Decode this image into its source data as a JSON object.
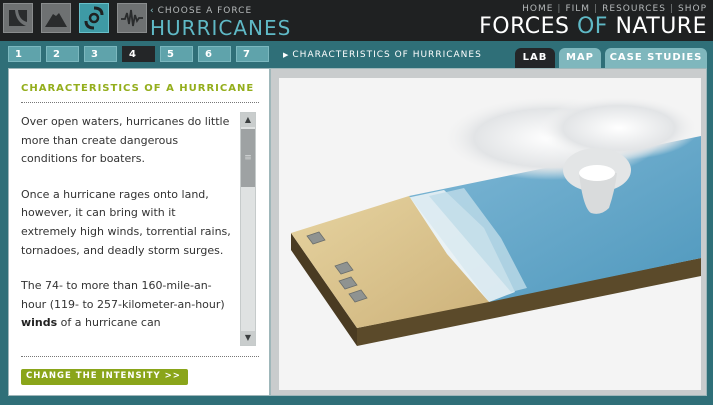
{
  "header": {
    "force_icons": [
      {
        "name": "earthquake-icon",
        "active": false
      },
      {
        "name": "volcano-icon",
        "active": false
      },
      {
        "name": "hurricane-icon",
        "active": true
      },
      {
        "name": "seismograph-icon",
        "active": false
      }
    ],
    "choose_force": "CHOOSE A FORCE",
    "force_name": "HURRICANES",
    "nav": [
      "HOME",
      "FILM",
      "RESOURCES",
      "SHOP"
    ],
    "brand_forces": "FORCES",
    "brand_of": "OF",
    "brand_nature": "NATURE"
  },
  "steps": {
    "tabs": [
      "1",
      "2",
      "3",
      "4",
      "5",
      "6",
      "7"
    ],
    "active": "4",
    "breadcrumb": "CHARACTERISTICS OF HURRICANES"
  },
  "modes": {
    "tabs": [
      "LAB",
      "MAP",
      "CASE STUDIES"
    ],
    "active": "LAB"
  },
  "content": {
    "title": "CHARACTERISTICS OF A HURRICANE",
    "p1": "Over open waters, hurricanes do little more than create dangerous conditions for boaters.",
    "p2": "Once a hurricane rages onto land, however, it can bring with it extremely high winds, torrential rains, tornadoes, and deadly storm surges.",
    "p3_before": "The 74- to more than 160-mile-an-hour (119- to 257-kilometer-an-hour) ",
    "p3_bold": "winds",
    "p3_after": " of a hurricane can",
    "intensity_button": "CHANGE THE INTENSITY >>"
  },
  "colors": {
    "accent_teal": "#5fb9c6",
    "accent_green": "#8aa51a",
    "dark_bar": "#1f2122"
  }
}
